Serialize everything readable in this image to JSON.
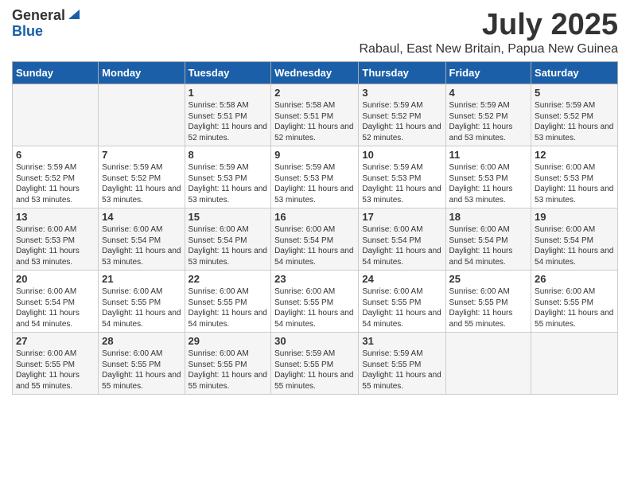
{
  "logo": {
    "general": "General",
    "blue": "Blue"
  },
  "title": "July 2025",
  "subtitle": "Rabaul, East New Britain, Papua New Guinea",
  "days_of_week": [
    "Sunday",
    "Monday",
    "Tuesday",
    "Wednesday",
    "Thursday",
    "Friday",
    "Saturday"
  ],
  "weeks": [
    [
      {
        "day": "",
        "info": ""
      },
      {
        "day": "",
        "info": ""
      },
      {
        "day": "1",
        "info": "Sunrise: 5:58 AM\nSunset: 5:51 PM\nDaylight: 11 hours and 52 minutes."
      },
      {
        "day": "2",
        "info": "Sunrise: 5:58 AM\nSunset: 5:51 PM\nDaylight: 11 hours and 52 minutes."
      },
      {
        "day": "3",
        "info": "Sunrise: 5:59 AM\nSunset: 5:52 PM\nDaylight: 11 hours and 52 minutes."
      },
      {
        "day": "4",
        "info": "Sunrise: 5:59 AM\nSunset: 5:52 PM\nDaylight: 11 hours and 53 minutes."
      },
      {
        "day": "5",
        "info": "Sunrise: 5:59 AM\nSunset: 5:52 PM\nDaylight: 11 hours and 53 minutes."
      }
    ],
    [
      {
        "day": "6",
        "info": "Sunrise: 5:59 AM\nSunset: 5:52 PM\nDaylight: 11 hours and 53 minutes."
      },
      {
        "day": "7",
        "info": "Sunrise: 5:59 AM\nSunset: 5:52 PM\nDaylight: 11 hours and 53 minutes."
      },
      {
        "day": "8",
        "info": "Sunrise: 5:59 AM\nSunset: 5:53 PM\nDaylight: 11 hours and 53 minutes."
      },
      {
        "day": "9",
        "info": "Sunrise: 5:59 AM\nSunset: 5:53 PM\nDaylight: 11 hours and 53 minutes."
      },
      {
        "day": "10",
        "info": "Sunrise: 5:59 AM\nSunset: 5:53 PM\nDaylight: 11 hours and 53 minutes."
      },
      {
        "day": "11",
        "info": "Sunrise: 6:00 AM\nSunset: 5:53 PM\nDaylight: 11 hours and 53 minutes."
      },
      {
        "day": "12",
        "info": "Sunrise: 6:00 AM\nSunset: 5:53 PM\nDaylight: 11 hours and 53 minutes."
      }
    ],
    [
      {
        "day": "13",
        "info": "Sunrise: 6:00 AM\nSunset: 5:53 PM\nDaylight: 11 hours and 53 minutes."
      },
      {
        "day": "14",
        "info": "Sunrise: 6:00 AM\nSunset: 5:54 PM\nDaylight: 11 hours and 53 minutes."
      },
      {
        "day": "15",
        "info": "Sunrise: 6:00 AM\nSunset: 5:54 PM\nDaylight: 11 hours and 53 minutes."
      },
      {
        "day": "16",
        "info": "Sunrise: 6:00 AM\nSunset: 5:54 PM\nDaylight: 11 hours and 54 minutes."
      },
      {
        "day": "17",
        "info": "Sunrise: 6:00 AM\nSunset: 5:54 PM\nDaylight: 11 hours and 54 minutes."
      },
      {
        "day": "18",
        "info": "Sunrise: 6:00 AM\nSunset: 5:54 PM\nDaylight: 11 hours and 54 minutes."
      },
      {
        "day": "19",
        "info": "Sunrise: 6:00 AM\nSunset: 5:54 PM\nDaylight: 11 hours and 54 minutes."
      }
    ],
    [
      {
        "day": "20",
        "info": "Sunrise: 6:00 AM\nSunset: 5:54 PM\nDaylight: 11 hours and 54 minutes."
      },
      {
        "day": "21",
        "info": "Sunrise: 6:00 AM\nSunset: 5:55 PM\nDaylight: 11 hours and 54 minutes."
      },
      {
        "day": "22",
        "info": "Sunrise: 6:00 AM\nSunset: 5:55 PM\nDaylight: 11 hours and 54 minutes."
      },
      {
        "day": "23",
        "info": "Sunrise: 6:00 AM\nSunset: 5:55 PM\nDaylight: 11 hours and 54 minutes."
      },
      {
        "day": "24",
        "info": "Sunrise: 6:00 AM\nSunset: 5:55 PM\nDaylight: 11 hours and 54 minutes."
      },
      {
        "day": "25",
        "info": "Sunrise: 6:00 AM\nSunset: 5:55 PM\nDaylight: 11 hours and 55 minutes."
      },
      {
        "day": "26",
        "info": "Sunrise: 6:00 AM\nSunset: 5:55 PM\nDaylight: 11 hours and 55 minutes."
      }
    ],
    [
      {
        "day": "27",
        "info": "Sunrise: 6:00 AM\nSunset: 5:55 PM\nDaylight: 11 hours and 55 minutes."
      },
      {
        "day": "28",
        "info": "Sunrise: 6:00 AM\nSunset: 5:55 PM\nDaylight: 11 hours and 55 minutes."
      },
      {
        "day": "29",
        "info": "Sunrise: 6:00 AM\nSunset: 5:55 PM\nDaylight: 11 hours and 55 minutes."
      },
      {
        "day": "30",
        "info": "Sunrise: 5:59 AM\nSunset: 5:55 PM\nDaylight: 11 hours and 55 minutes."
      },
      {
        "day": "31",
        "info": "Sunrise: 5:59 AM\nSunset: 5:55 PM\nDaylight: 11 hours and 55 minutes."
      },
      {
        "day": "",
        "info": ""
      },
      {
        "day": "",
        "info": ""
      }
    ]
  ]
}
